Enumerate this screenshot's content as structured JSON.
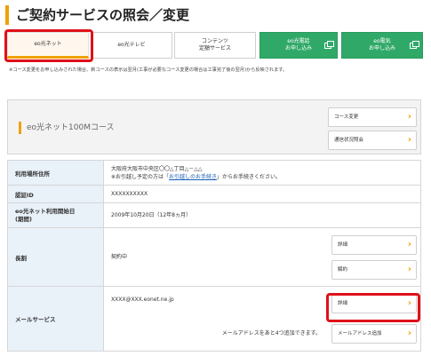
{
  "page": {
    "title": "ご契約サービスの照会／変更"
  },
  "tabs": [
    {
      "label": "eo光ネット",
      "selected": true
    },
    {
      "label": "eo光テレビ"
    },
    {
      "label": "コンテンツ\n定額サービス"
    },
    {
      "label": "eo光電話\nお申し込み",
      "external": true
    },
    {
      "label": "eo電気\nお申し込み",
      "external": true
    }
  ],
  "note": "※コース変更をお申し込みされた場合、新コースの表示は翌月(工事が必要なコース変更の場合は工事完了後の翌月)から反映されます。",
  "course": {
    "name": "eo光ネット100Mコース",
    "buttons": {
      "change": "コース変更",
      "status": "通信状況照会"
    }
  },
  "table": {
    "address": {
      "label": "利用場所住所",
      "line1": "大阪府大阪市中央区〇〇△丁目△－△△",
      "line2_pre": "※お引越し予定の方は「",
      "line2_link": "お引越しのお手続き",
      "line2_post": "」からお手続きください。"
    },
    "auth_id": {
      "label": "認証ID",
      "value": "XXXXXXXXXX"
    },
    "start_date": {
      "label": "eo光ネット利用開始日\n(期間)",
      "value": "2009年10月20日（12年8ヵ月）"
    },
    "contract": {
      "label": "長割",
      "value": "契約中",
      "btn_detail": "詳細",
      "btn_cancel": "解約"
    },
    "mail": {
      "label": "メールサービス",
      "address": "XXXX@XXX.eonet.ne.jp",
      "btn_detail": "詳細",
      "remaining": "メールアドレスをあと4つ追加できます。",
      "btn_add": "メールアドレス追加"
    }
  },
  "colors": {
    "accent": "#f0a000",
    "green": "#30a968",
    "highlight": "#e0101a",
    "label_bg": "#e9f1f9"
  }
}
